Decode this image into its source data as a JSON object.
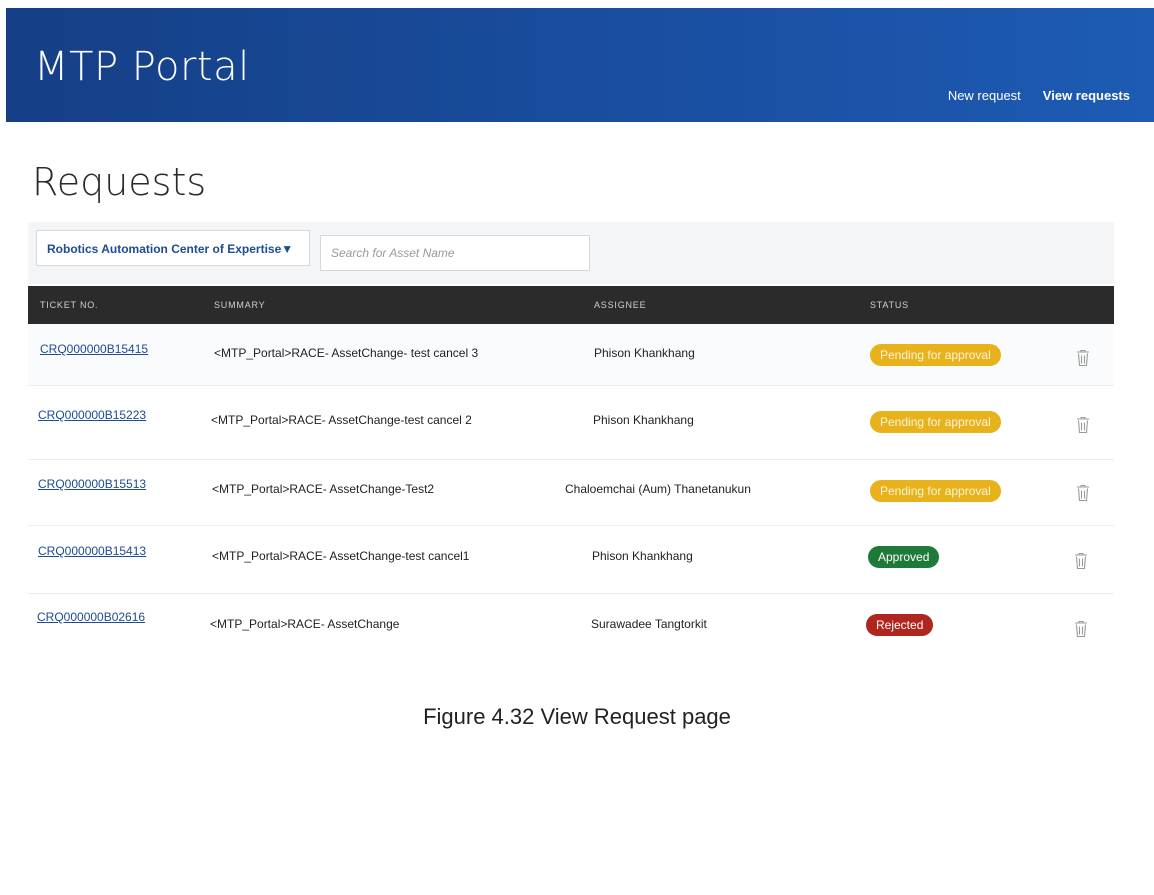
{
  "app": {
    "title": "MTP Portal",
    "nav": [
      {
        "label": "New request"
      },
      {
        "label": "View requests"
      }
    ]
  },
  "page": {
    "title": "Requests"
  },
  "filters": {
    "department": "Robotics Automation Center of Expertise▼",
    "search_placeholder": "Search for Asset Name"
  },
  "table": {
    "columns": [
      "TICKET NO.",
      "SUMMARY",
      "ASSIGNEE",
      "STATUS"
    ],
    "rows": [
      {
        "ticket": "CRQ000000B15415",
        "summary": "<MTP_Portal>RACE- AssetChange- test cancel 3",
        "assignee": "Phison Khankhang",
        "status": "Pending for approval"
      },
      {
        "ticket": "CRQ000000B15223",
        "summary": "<MTP_Portal>RACE- AssetChange-test cancel 2",
        "assignee": "Phison Khankhang",
        "status": "Pending for approval"
      },
      {
        "ticket": "CRQ000000B15513",
        "summary": "<MTP_Portal>RACE- AssetChange-Test2",
        "assignee": "Chaloemchai (Aum) Thanetanukun",
        "status": "Pending for approval"
      },
      {
        "ticket": "CRQ000000B15413",
        "summary": "<MTP_Portal>RACE- AssetChange-test cancel1",
        "assignee": "Phison Khankhang",
        "status": "Approved"
      },
      {
        "ticket": "CRQ000000B02616",
        "summary": "<MTP_Portal>RACE- AssetChange",
        "assignee": "Surawadee Tangtorkit",
        "status": "Rejected"
      }
    ]
  },
  "caption": {
    "label": "Figure 4.32",
    "text": "View Request page"
  },
  "colors": {
    "header": "#1a4ea0",
    "pending": "#e7b21c",
    "approved": "#1f7a3a",
    "rejected": "#b0261f",
    "link": "#1d4c92"
  }
}
